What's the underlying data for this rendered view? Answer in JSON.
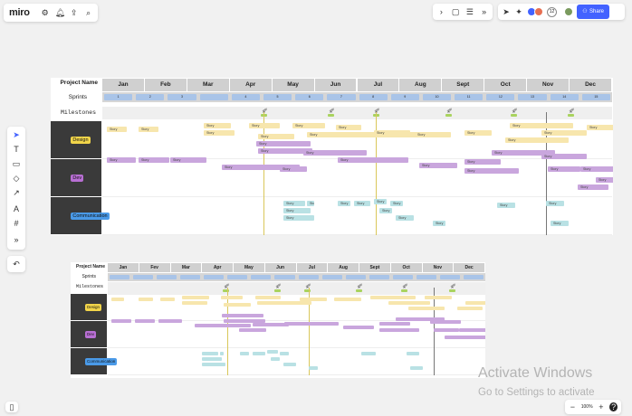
{
  "app": {
    "logo": "miro",
    "share_label": "Share",
    "collaborator_count": "12",
    "zoom": "100%"
  },
  "board1": {
    "project_label": "Project Name",
    "sprints_label": "Sprints",
    "milestones_label": "Milestones",
    "months": [
      "Jan",
      "Feb",
      "Mar",
      "Apr",
      "May",
      "Jun",
      "Jul",
      "Aug",
      "Sept",
      "Oct",
      "Nov",
      "Dec"
    ],
    "sprints": [
      "1",
      "2",
      "3",
      "",
      "4",
      "5",
      "6",
      "7",
      "8",
      "9",
      "10",
      "11",
      "12",
      "13",
      "14",
      "15"
    ],
    "teams": [
      "Design",
      "Dev",
      "Communication"
    ],
    "bar_label": "Story"
  },
  "board2": {
    "project_label": "Project Name",
    "sprints_label": "Sprints",
    "milestones_label": "Milestones",
    "months": [
      "Jan",
      "Fev",
      "Mar",
      "Apr",
      "May",
      "Jun",
      "Jul",
      "Aug",
      "Sept",
      "Oct",
      "Nov",
      "Dec"
    ],
    "teams": [
      "Design",
      "Dev",
      "Communication"
    ]
  },
  "watermark": {
    "title": "Activate Windows",
    "subtitle": "Go to Settings to activate"
  },
  "colors": {
    "design": "#f7e6ad",
    "dev": "#c9a6dd",
    "comm": "#b9e1e4",
    "sprint": "#a9c4e8",
    "header": "#d0d0d0",
    "accent": "#4262ff"
  }
}
